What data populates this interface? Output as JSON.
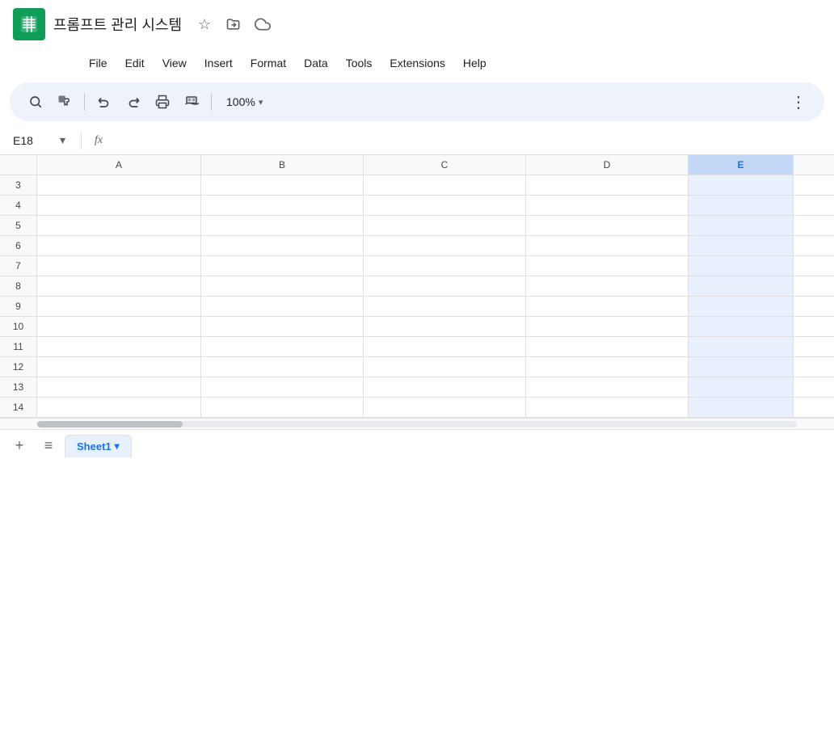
{
  "app": {
    "icon_alt": "Google Sheets",
    "title": "프롬프트 관리 시스템",
    "icons": [
      "star",
      "folder-move",
      "cloud"
    ]
  },
  "menu": {
    "items": [
      "File",
      "Edit",
      "View",
      "Insert",
      "Format",
      "Data",
      "Tools",
      "Extensions",
      "Help"
    ]
  },
  "toolbar": {
    "zoom": "100%",
    "zoom_arrow": "▾",
    "more_label": "⋮"
  },
  "formula_bar": {
    "cell_ref": "E18",
    "fx_symbol": "fx"
  },
  "columns": {
    "headers": [
      "A",
      "B",
      "C",
      "D",
      "E"
    ]
  },
  "rows": {
    "numbers": [
      3,
      4,
      5,
      6,
      7,
      8,
      9,
      10,
      11,
      12,
      13,
      14
    ]
  },
  "sheets": {
    "add_label": "+",
    "menu_label": "≡",
    "active_sheet": "Sheet1",
    "arrow_label": "▾"
  }
}
